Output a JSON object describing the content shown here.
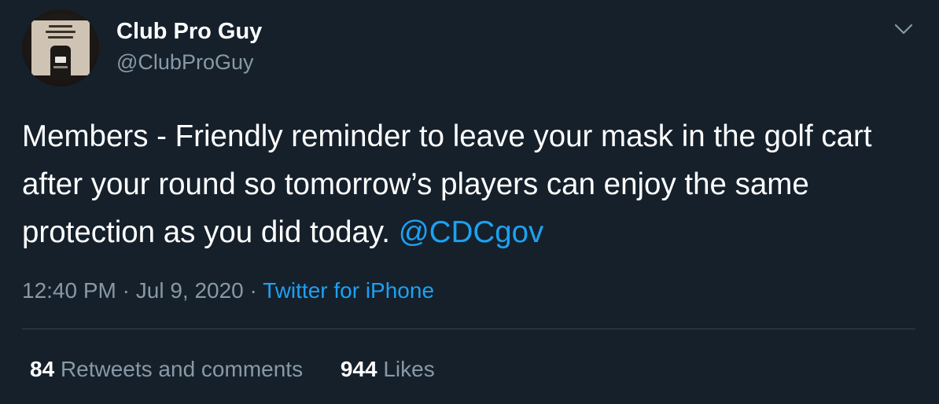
{
  "tweet": {
    "author": {
      "name": "Club Pro Guy",
      "handle": "@ClubProGuy"
    },
    "text_before_mention": "Members - Friendly reminder to leave your mask in the golf cart after your round so tomorrow’s players can enjoy the same protection as you did today. ",
    "mention": "@CDCgov",
    "time": "12:40 PM",
    "separator": " · ",
    "date": "Jul 9, 2020",
    "source": "Twitter for iPhone",
    "retweets_count": "84",
    "retweets_label": "Retweets and comments",
    "likes_count": "944",
    "likes_label": "Likes"
  },
  "icons": {
    "menu": "chevron-down-icon"
  },
  "colors": {
    "background": "#15202b",
    "text": "#ffffff",
    "secondary": "#8899a6",
    "accent": "#1da1f2",
    "divider": "#38444d"
  }
}
